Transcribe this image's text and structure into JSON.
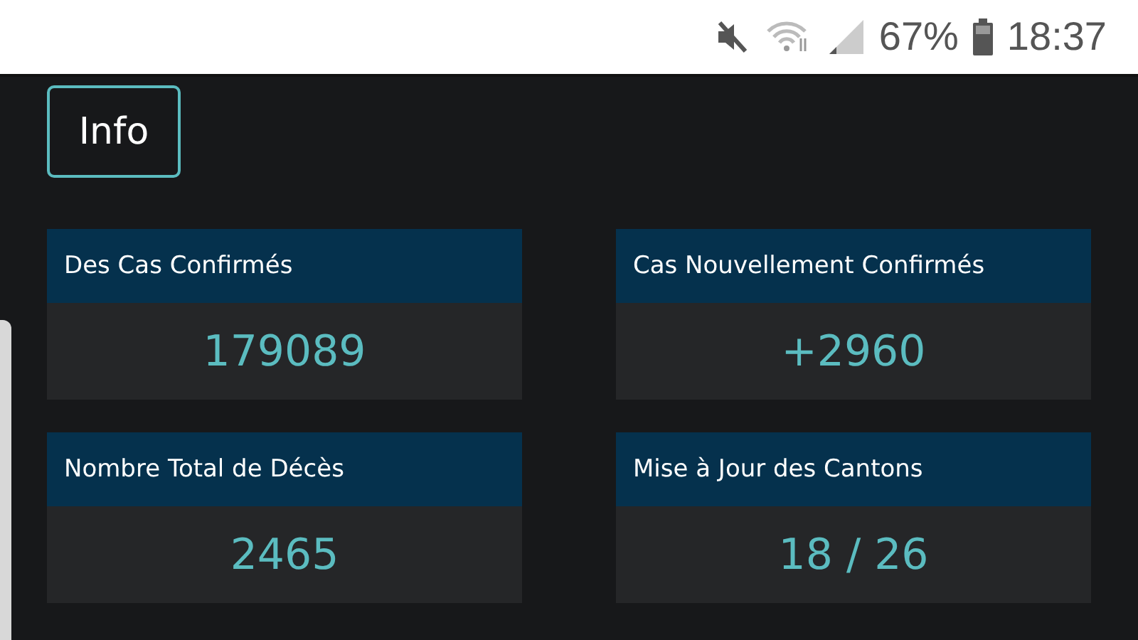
{
  "status_bar": {
    "battery": "67%",
    "time": "18:37"
  },
  "info_button": {
    "label": "Info"
  },
  "cards": [
    {
      "title": "Des Cas Confirmés",
      "value": "179089"
    },
    {
      "title": "Cas Nouvellement Confirmés",
      "value": "+2960"
    },
    {
      "title": "Nombre Total de Décès",
      "value": "2465"
    },
    {
      "title": "Mise à Jour des Cantons",
      "value": "18 / 26"
    }
  ]
}
